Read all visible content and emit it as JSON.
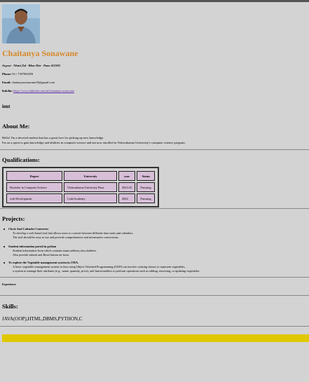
{
  "profile": {
    "name": "Chaitanya Sonawane",
    "address": "At.post - Nhavi,Tal - Bhor Dist - Pune 412203",
    "phone_label": "Phone:",
    "phone": "91+ 7397963959",
    "email_label": "Email:",
    "email": "chaitanyasonawane19@gmail.com",
    "linkedin_label": "linkdin:",
    "linkedin": "https://www.linkedin.com/in/chaitanya-sonawane"
  },
  "fragment": "ient",
  "about": {
    "heading": "About Me:",
    "line1": "Hello! I'm a devoted student that has a great love for picking up new knowledge.",
    "line2": "I'm on a quest to gain knowledge and abilities in computer science and am now enrolled in Vishwakarma University's computer science program."
  },
  "qualifications": {
    "heading": "Qualifications:",
    "headers": [
      "Degree",
      "University",
      "year",
      "Status"
    ],
    "rows": [
      [
        "Bachelor in Computer Science",
        "Vishwakarma University Pune",
        "2023-25",
        "Pursuing"
      ],
      [
        "web Development",
        "CodeAcademy",
        "2024",
        "Pursuing"
      ]
    ]
  },
  "projects": {
    "heading": "Projects:",
    "items": [
      {
        "title": "Clock And Calender Converter",
        "desc1": "To develop a web-based tool that allows users to convert between different time units and calendars.",
        "desc2": "The tool should be easy to use and provide comprehensive and informative conversions."
      },
      {
        "title": "Student information portal in python",
        "desc1": "Student information form which contains name,address,class,hobbies.",
        "desc2": "Also provide submit and Reset button on form."
      },
      {
        "title": "To explore the Vegetable management system in JAVA.",
        "desc1": "A basic vegetable management system in Java using Object-Oriented Programming (OOP) can involve creating classes to represent vegetables,",
        "desc2": "a system to manage their attributes (e.g., name, quantity, price), and functionalities to perform operations such as adding, removing, or updating vegetables"
      }
    ]
  },
  "experience_label": "Experience:",
  "skills": {
    "heading": "Skills:",
    "list": "JAVA(OOP),HTML,DBMS,PYTHON,C"
  },
  "colors": {
    "name": "#d6882a",
    "accent_bar": "#e0c800",
    "table_cell": "#d8bfd8",
    "link": "#5a2aa8"
  }
}
